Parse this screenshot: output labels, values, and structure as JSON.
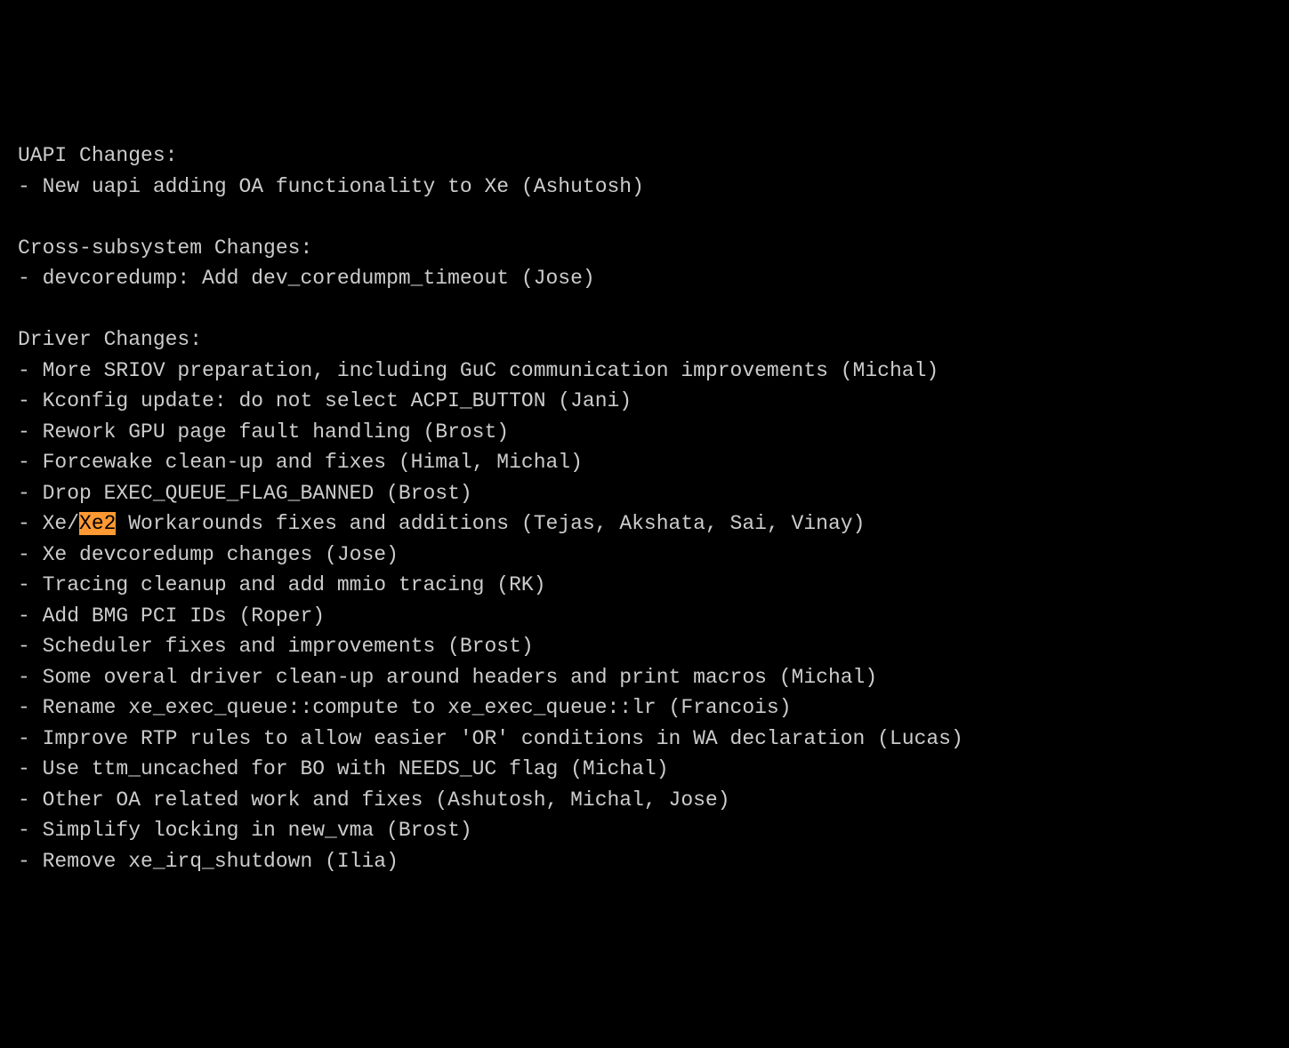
{
  "sections": [
    {
      "header": "UAPI Changes:",
      "items": [
        "- New uapi adding OA functionality to Xe (Ashutosh)"
      ]
    },
    {
      "header": "Cross-subsystem Changes:",
      "items": [
        "- devcoredump: Add dev_coredumpm_timeout (Jose)"
      ]
    },
    {
      "header": "Driver Changes:",
      "items": [
        "- More SRIOV preparation, including GuC communication improvements (Michal)",
        "- Kconfig update: do not select ACPI_BUTTON (Jani)",
        "- Rework GPU page fault handling (Brost)",
        "- Forcewake clean-up and fixes (Himal, Michal)",
        "- Drop EXEC_QUEUE_FLAG_BANNED (Brost)",
        {
          "prefix": "- Xe/",
          "highlight": "Xe2",
          "suffix": " Workarounds fixes and additions (Tejas, Akshata, Sai, Vinay)"
        },
        "- Xe devcoredump changes (Jose)",
        "- Tracing cleanup and add mmio tracing (RK)",
        "- Add BMG PCI IDs (Roper)",
        "- Scheduler fixes and improvements (Brost)",
        "- Some overal driver clean-up around headers and print macros (Michal)",
        "- Rename xe_exec_queue::compute to xe_exec_queue::lr (Francois)",
        "- Improve RTP rules to allow easier 'OR' conditions in WA declaration (Lucas)",
        "- Use ttm_uncached for BO with NEEDS_UC flag (Michal)",
        "- Other OA related work and fixes (Ashutosh, Michal, Jose)",
        "- Simplify locking in new_vma (Brost)",
        "- Remove xe_irq_shutdown (Ilia)"
      ]
    }
  ]
}
